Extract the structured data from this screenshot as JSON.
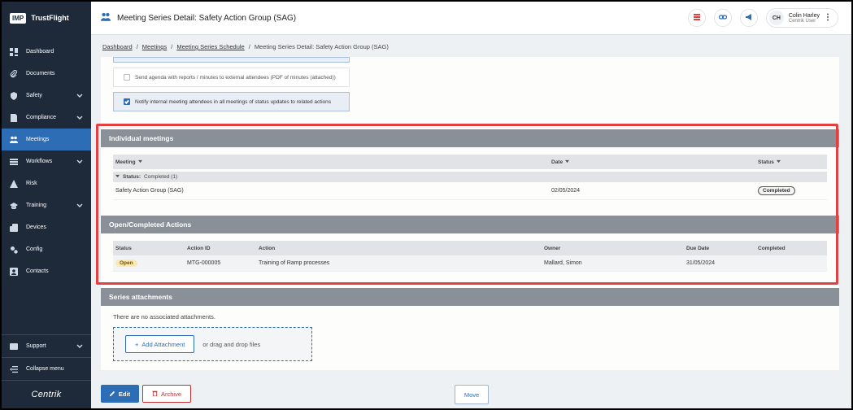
{
  "brand": {
    "logo": "IMP",
    "name": "TrustFlight",
    "footer": "Centrik"
  },
  "sidebar": {
    "items": [
      {
        "label": "Dashboard",
        "icon": "dashboard-icon",
        "chevron": false,
        "active": false
      },
      {
        "label": "Documents",
        "icon": "paperclip-icon",
        "chevron": false,
        "active": false
      },
      {
        "label": "Safety",
        "icon": "shield-icon",
        "chevron": true,
        "active": false
      },
      {
        "label": "Compliance",
        "icon": "compliance-icon",
        "chevron": true,
        "active": false
      },
      {
        "label": "Meetings",
        "icon": "meetings-icon",
        "chevron": false,
        "active": true
      },
      {
        "label": "Workflows",
        "icon": "workflow-icon",
        "chevron": true,
        "active": false
      },
      {
        "label": "Risk",
        "icon": "warning-icon",
        "chevron": false,
        "active": false
      },
      {
        "label": "Training",
        "icon": "graduation-icon",
        "chevron": true,
        "active": false
      },
      {
        "label": "Devices",
        "icon": "devices-icon",
        "chevron": false,
        "active": false
      },
      {
        "label": "Config",
        "icon": "config-icon",
        "chevron": false,
        "active": false
      },
      {
        "label": "Contacts",
        "icon": "contacts-icon",
        "chevron": false,
        "active": false
      }
    ],
    "support": "Support",
    "collapse": "Collapse menu"
  },
  "header": {
    "title": "Meeting Series Detail: Safety Action Group (SAG)",
    "user_initials": "CH",
    "user_name": "Colin Harley",
    "user_role": "Centrik User"
  },
  "breadcrumb": {
    "items": [
      "Dashboard",
      "Meetings",
      "Meeting Series Schedule"
    ],
    "current": "Meeting Series Detail: Safety Action Group (SAG)"
  },
  "options": {
    "send_agenda": "Send agenda with reports / minutes to external attendees (PDF of minutes (attached))",
    "notify_internal": "Notify internal meeting attendees in all meetings of status updates to related actions"
  },
  "individual_meetings": {
    "title": "Individual meetings",
    "columns": {
      "meeting": "Meeting",
      "date": "Date",
      "status": "Status"
    },
    "group_label": "Status:",
    "group_value": "Completed (1)",
    "rows": [
      {
        "meeting": "Safety Action Group (SAG)",
        "date": "02/05/2024",
        "status": "Completed"
      }
    ]
  },
  "actions": {
    "title": "Open/Completed Actions",
    "columns": {
      "status": "Status",
      "action_id": "Action ID",
      "action": "Action",
      "owner": "Owner",
      "due_date": "Due Date",
      "completed": "Completed"
    },
    "rows": [
      {
        "status": "Open",
        "action_id": "MTG-000005",
        "action": "Training of Ramp processes",
        "owner": "Mallard, Simon",
        "due_date": "31/05/2024",
        "completed": ""
      }
    ]
  },
  "attachments": {
    "title": "Series attachments",
    "empty": "There are no associated attachments.",
    "add_label": "Add Attachment",
    "drag_text": "or drag and drop files"
  },
  "footer": {
    "edit": "Edit",
    "archive": "Archive",
    "move": "Move"
  },
  "colors": {
    "accent": "#2d6db5",
    "sidebar": "#1e2a3a",
    "highlight": "#e54041",
    "danger": "#c43030"
  }
}
